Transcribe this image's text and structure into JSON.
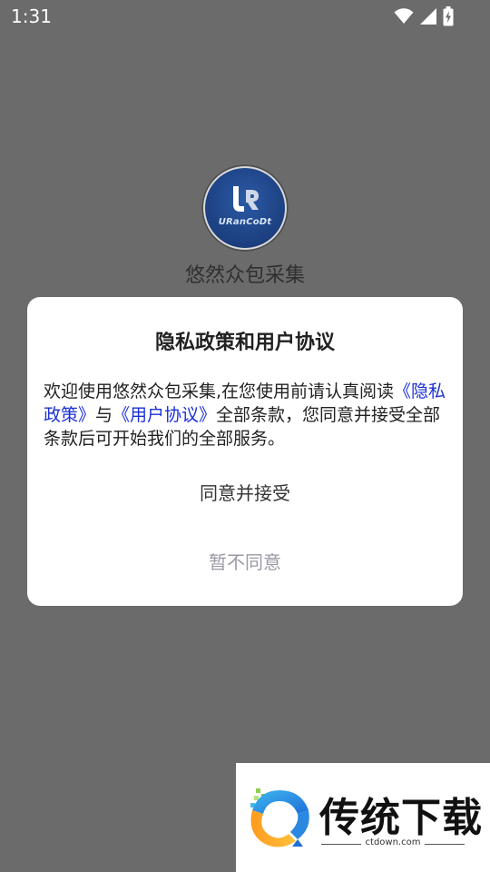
{
  "status_bar": {
    "time": "1:31",
    "icons": [
      "wifi-icon",
      "signal-icon",
      "battery-charging-icon"
    ]
  },
  "splash": {
    "logo_text": "URanCoDt",
    "app_name": "悠然众包采集"
  },
  "dialog": {
    "title": "隐私政策和用户协议",
    "body": {
      "part1": "欢迎使用悠然众包采集,在您使用前请认真阅读",
      "privacy_link": "《隐私政策》",
      "part2": "与",
      "agreement_link": "《用户协议》",
      "part3": "全部条款，您同意并接受全部条款后可开始我们的全部服务。"
    },
    "agree_label": "同意并接受",
    "decline_label": "暂不同意",
    "link_color": "#1a2fd6"
  },
  "watermark": {
    "title": "传统下载",
    "url": "ctdown.com"
  }
}
